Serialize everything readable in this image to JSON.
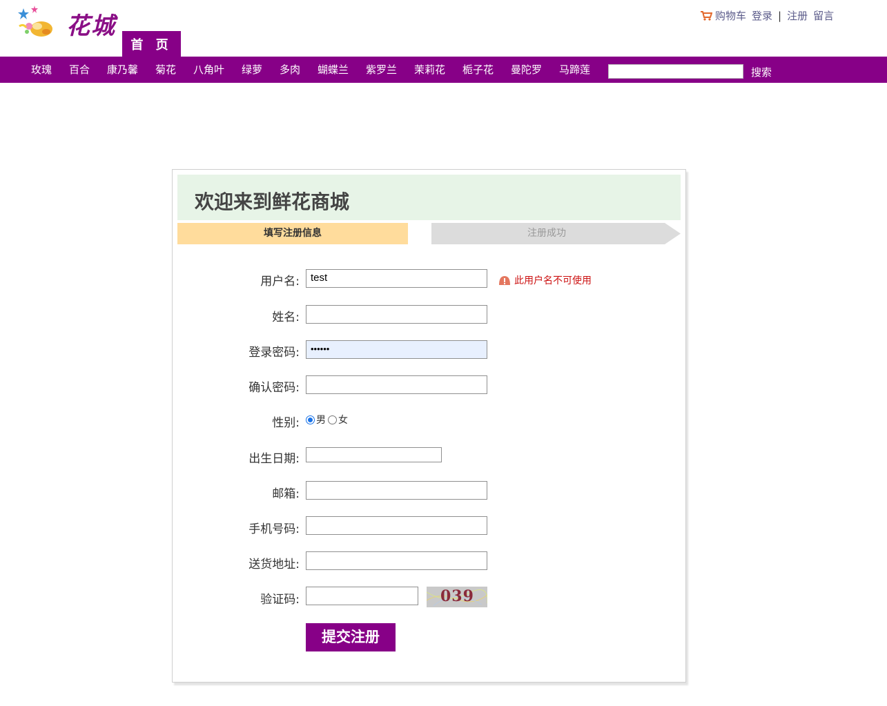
{
  "header": {
    "logo_text": "花城",
    "home_tab": "首 页",
    "cart": "购物车",
    "login": "登录",
    "separator": "|",
    "register": "注册",
    "message": "留言"
  },
  "nav": {
    "items": [
      "玫瑰",
      "百合",
      "康乃馨",
      "菊花",
      "八角叶",
      "绿萝",
      "多肉",
      "蝴蝶兰",
      "紫罗兰",
      "茉莉花",
      "栀子花",
      "曼陀罗",
      "马蹄莲"
    ],
    "search_value": "",
    "search_button": "搜索"
  },
  "form": {
    "welcome": "欢迎来到鲜花商城",
    "steps": [
      "填写注册信息",
      "注册成功"
    ],
    "fields": {
      "username": {
        "label": "用户名:",
        "value": "test",
        "error": "此用户名不可使用"
      },
      "name": {
        "label": "姓名:",
        "value": ""
      },
      "password": {
        "label": "登录密码:",
        "value": "••••••"
      },
      "confirm": {
        "label": "确认密码:",
        "value": ""
      },
      "gender": {
        "label": "性别:",
        "options": [
          "男",
          "女"
        ],
        "selected": "男"
      },
      "birthday": {
        "label": "出生日期:",
        "value": ""
      },
      "email": {
        "label": "邮箱:",
        "value": ""
      },
      "phone": {
        "label": "手机号码:",
        "value": ""
      },
      "address": {
        "label": "送货地址:",
        "value": ""
      },
      "captcha": {
        "label": "验证码:",
        "value": "",
        "image_text": "039"
      }
    },
    "submit": "提交注册"
  },
  "colors": {
    "brand": "#870087",
    "welcome_bg": "#e7f4e7",
    "step_active": "#ffd99a",
    "step_inactive": "#dcdcdc",
    "error": "#cc1111"
  }
}
